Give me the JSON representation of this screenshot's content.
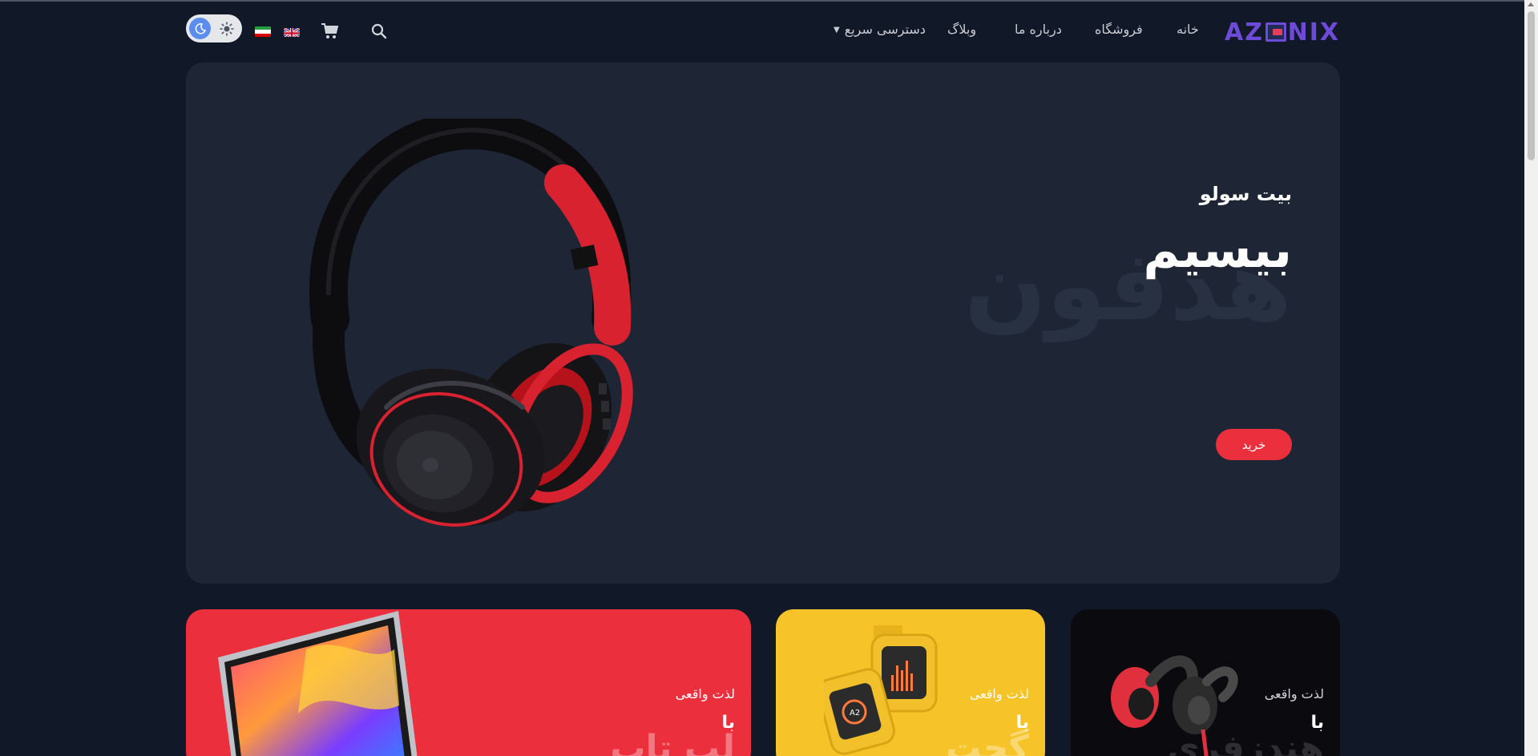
{
  "header": {
    "logo_text": "AZ",
    "logo_text_end": "NIX",
    "nav": {
      "home": "خانه",
      "shop": "فروشگاه",
      "about": "درباره ما",
      "blog": "وبلاگ",
      "quick_access": "دسترسی سریع"
    },
    "icons": [
      "search-icon",
      "cart-icon",
      "flag-iran-icon",
      "flag-uk-icon",
      "moon-icon",
      "sun-icon"
    ],
    "accent_color": "#6d4bd8"
  },
  "hero": {
    "subtitle": "بیت سولو",
    "title": "بیسیم",
    "watermark": "هدفون",
    "buy_label": "خرید",
    "image": "headphones-image",
    "background": "#1e2636",
    "button_color": "#ec2f3d"
  },
  "cards": [
    {
      "label": "لذت واقعی",
      "title": "با",
      "ghost": "لپ تاپ",
      "color": "#ec2f3d",
      "image": "laptop-image"
    },
    {
      "label": "لذت واقعی",
      "title": "با",
      "ghost": "گجت",
      "color": "#f6c429",
      "image": "smartwatch-image"
    },
    {
      "label": "لذت واقعی",
      "title": "با",
      "ghost": "هندزفری",
      "color": "#0a0a0f",
      "image": "earbuds-image"
    }
  ]
}
